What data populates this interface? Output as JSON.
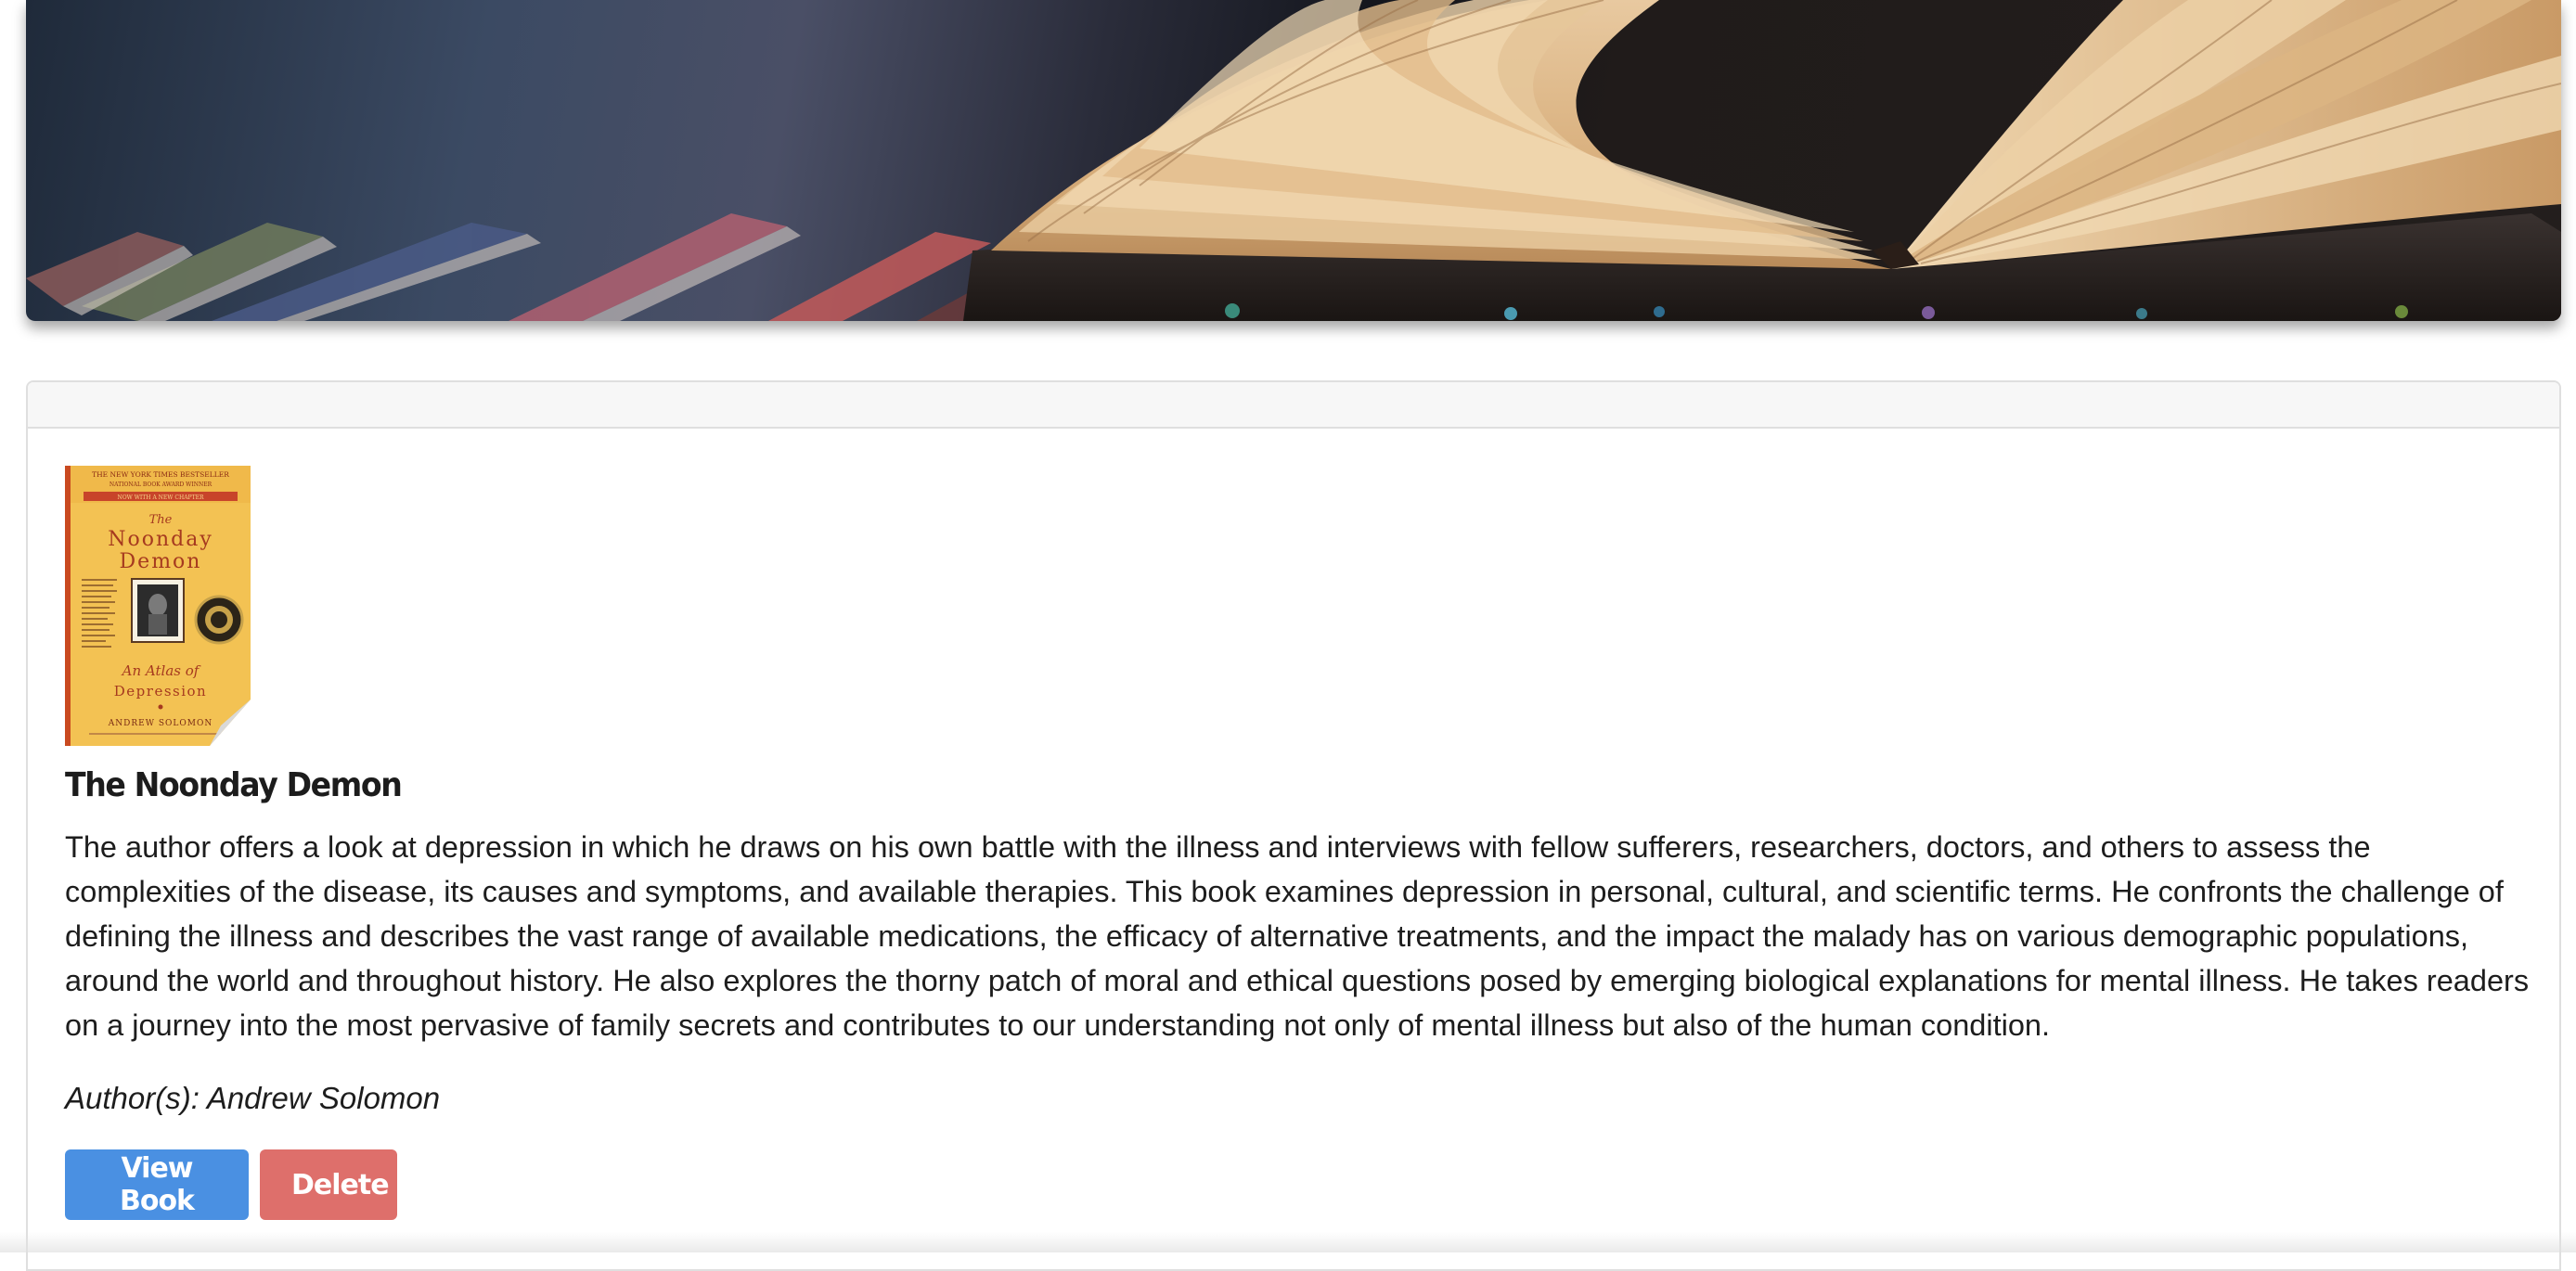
{
  "hero": {
    "image": "open-book-banner"
  },
  "card": {
    "header": "",
    "book": {
      "cover": {
        "top_line": "THE NEW YORK TIMES BESTSELLER",
        "sub_line": "NATIONAL BOOK AWARD WINNER",
        "band": "NOW WITH A NEW CHAPTER",
        "title_the": "The",
        "title_1": "Noonday",
        "title_2": "Demon",
        "subtitle_1": "An Atlas of",
        "subtitle_2": "Depression",
        "author": "ANDREW SOLOMON"
      },
      "title": "The Noonday Demon",
      "description": "The author offers a look at depression in which he draws on his own battle with the illness and interviews with fellow sufferers, researchers, doctors, and others to assess the complexities of the disease, its causes and symptoms, and available therapies. This book examines depression in personal, cultural, and scientific terms. He confronts the challenge of defining the illness and describes the vast range of available medications, the efficacy of alternative treatments, and the impact the malady has on various demographic populations, around the world and throughout history. He also explores the thorny patch of moral and ethical questions posed by emerging biological explanations for mental illness. He takes readers on a journey into the most pervasive of family secrets and contributes to our understanding not only of mental illness but also of the human condition.",
      "authors_label": "Author(s): Andrew Solomon"
    },
    "actions": {
      "view_label": "View Book",
      "delete_label": "Delete"
    }
  },
  "colors": {
    "view_button": "#4a90e2",
    "delete_button": "#de6f6b",
    "card_header_bg": "#f7f7f7"
  }
}
